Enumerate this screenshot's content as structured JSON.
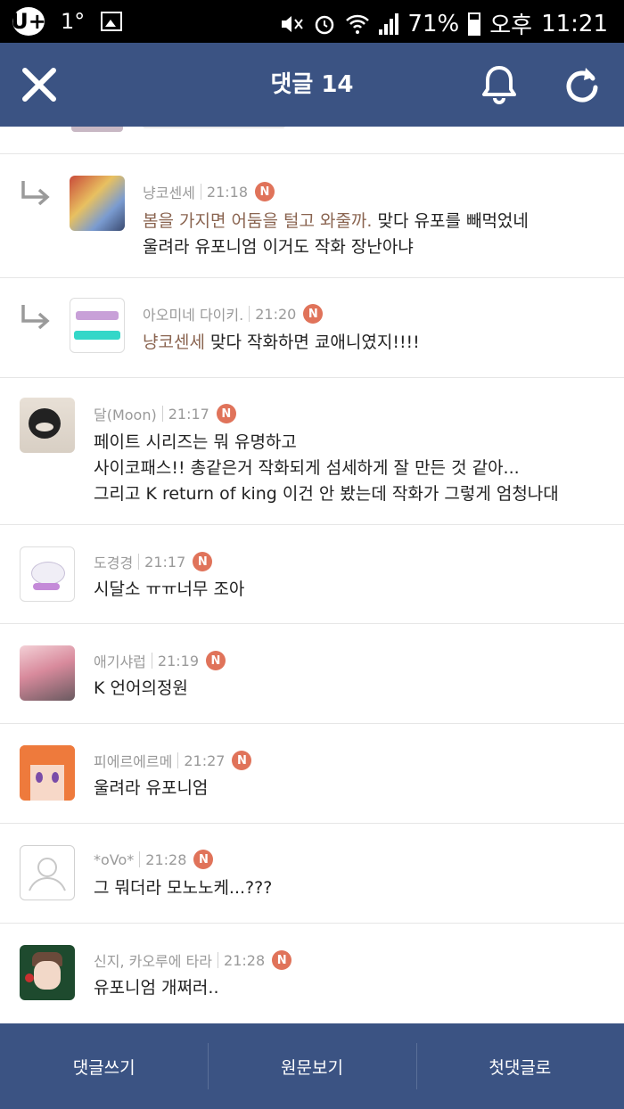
{
  "status_bar": {
    "carrier_icon": "U+",
    "temperature": "1°",
    "battery": "71%",
    "ampm": "오후",
    "time": "11:21"
  },
  "header": {
    "title": "댓글 14"
  },
  "comments": [
    {
      "author": "냥코센세",
      "time": "21:18",
      "badge": "N",
      "reply": true,
      "mention": "봄을 가지면 어둠을 털고 와줄까.",
      "line1": " 맞다 유포를 빼먹었네",
      "line2": "울려라 유포니엄 이거도 작화 장난아냐"
    },
    {
      "author": "아오미네 다이키.",
      "time": "21:20",
      "badge": "N",
      "reply": true,
      "mention": "냥코센세",
      "line1": " 맞다 작화하면 쿄애니였지!!!!"
    },
    {
      "author": "달(Moon)",
      "time": "21:17",
      "badge": "N",
      "reply": false,
      "line1": "페이트 시리즈는 뭐 유명하고",
      "line2": "사이코패스!! 총같은거 작화되게 섬세하게 잘 만든 것 같아...",
      "line3": "그리고 K return of king 이건 안 봤는데 작화가 그렇게 엄청나대"
    },
    {
      "author": "도경경",
      "time": "21:17",
      "badge": "N",
      "reply": false,
      "line1": "시달소 ㅠㅠ너무 조아"
    },
    {
      "author": "애기샤럽",
      "time": "21:19",
      "badge": "N",
      "reply": false,
      "line1": "K 언어의정원"
    },
    {
      "author": "피에르에르메",
      "time": "21:27",
      "badge": "N",
      "reply": false,
      "line1": "울려라 유포니엄"
    },
    {
      "author": "*oVo*",
      "time": "21:28",
      "badge": "N",
      "reply": false,
      "line1": "그 뭐더라 모노노케...???"
    },
    {
      "author": "신지, 카오루에 타라",
      "time": "21:28",
      "badge": "N",
      "reply": false,
      "line1": "유포니엄 개쩌러.."
    }
  ],
  "bottom_bar": {
    "write": "댓글쓰기",
    "original": "원문보기",
    "first": "첫댓글로"
  },
  "colors": {
    "header": "#3b5383",
    "badge": "#e0735a",
    "mention": "#8a6450"
  }
}
